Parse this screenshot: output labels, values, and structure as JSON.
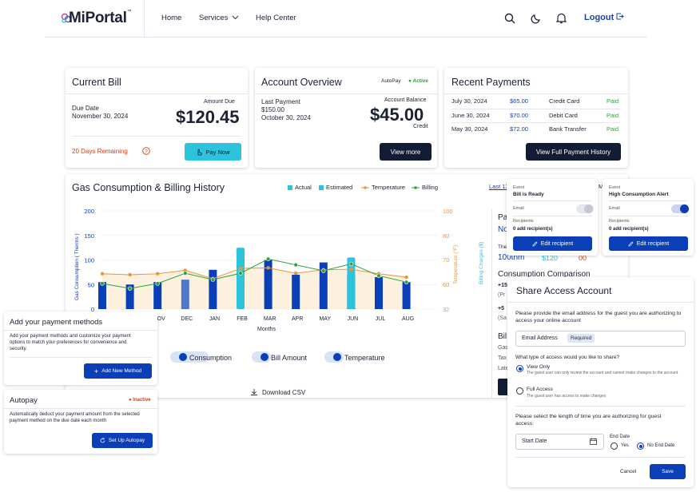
{
  "header": {
    "logo": "MiPortal",
    "logo_tm": "™",
    "nav": [
      "Home",
      "Services",
      "Help Center"
    ],
    "logout": "Logout"
  },
  "current_bill": {
    "title": "Current Bill",
    "due_label": "Due Date",
    "due_date": "November 30, 2024",
    "amount_label": "Amount Due",
    "amount": "$120.45",
    "remaining": "20 Days Remaining",
    "pay_button": "Pay Now"
  },
  "account_overview": {
    "title": "Account Overview",
    "autopay_label": "AutoPay",
    "autopay_status": "Active",
    "last_payment_label": "Last Payment",
    "last_payment_amount": "$150.00",
    "last_payment_date": "October 30, 2024",
    "balance_label": "Account Balance",
    "balance": "$45.00",
    "balance_note": "Credit",
    "view_button": "View more"
  },
  "recent_payments": {
    "title": "Recent Payments",
    "rows": [
      {
        "date": "July 30, 2024",
        "amount": "$65.00",
        "method": "Credit Card",
        "status": "Paid"
      },
      {
        "date": "June 30, 2024",
        "amount": "$70.00",
        "method": "Debit Card",
        "status": "Paid"
      },
      {
        "date": "May 30, 2024",
        "amount": "$72.00",
        "method": "Bank Transfer",
        "status": "Paid"
      }
    ],
    "history_button": "View Full Payment History"
  },
  "chart_panel": {
    "title": "Gas Consumption & Billing History",
    "legend": [
      "Actual",
      "Estimated",
      "Temperature",
      "Billing"
    ],
    "last_link": "Last 13",
    "y_left_label": "Gas Consumption ( Therms )",
    "y_right_label1": "Temperature (°F)",
    "y_right_label2": "Billing Charges ($)",
    "x_label": "Months",
    "toggles": [
      "Consumption",
      "Bill Amount",
      "Temperature"
    ],
    "download": "Download CSV"
  },
  "chart_data": {
    "type": "bar",
    "categories": [
      "OCT",
      "NOV",
      "DEC",
      "JAN",
      "FEB",
      "MAR",
      "APR",
      "MAY",
      "JUN",
      "JUL",
      "AUG"
    ],
    "visible_categories": [
      "CT",
      "NOV",
      "DEC",
      "JAN",
      "FEB",
      "MAR",
      "APR",
      "MAY",
      "JUN",
      "JUL",
      "AUG"
    ],
    "y_ticks": [
      0,
      50,
      100,
      150,
      200
    ],
    "y2_ticks": [
      32,
      60,
      70,
      80,
      100
    ],
    "ylim": [
      0,
      200
    ],
    "series": [
      {
        "name": "Actual",
        "values": [
          55,
          50,
          55,
          60,
          80,
          0,
          100,
          70,
          95,
          70,
          65,
          55
        ]
      },
      {
        "name": "Estimated",
        "values": [
          0,
          0,
          0,
          0,
          0,
          125,
          0,
          0,
          0,
          105,
          0,
          0
        ]
      },
      {
        "name": "Temperature",
        "values": [
          72,
          70,
          72,
          79,
          62,
          83,
          84,
          73,
          80,
          81,
          72,
          65
        ]
      },
      {
        "name": "Billing",
        "values": [
          52,
          42,
          52,
          73,
          60,
          73,
          102,
          90,
          78,
          92,
          68,
          55
        ]
      }
    ],
    "note": "first 3 bars partially hidden"
  },
  "side_panel": {
    "pa": "Pa",
    "no": "No",
    "the": "The",
    "usage": "100thm",
    "usage_amt": "$120",
    "extra": "00",
    "consumption_comparison": "Consumption Comparison",
    "plus15": "+15",
    "pr": "(Pr",
    "plus5": "+5",
    "sa": "(Sa",
    "bil": "Bil",
    "gas": "Gas",
    "tax": "Tax",
    "late": "Late"
  },
  "notif1": {
    "event_label": "Event",
    "event": "Bill is Ready",
    "email_label": "Email",
    "recipients_label": "Recipients",
    "recipients": "0 add recipient(s)",
    "button": "Edit recipient"
  },
  "notif2": {
    "event_label": "Event",
    "event": "High Consumption Alert",
    "email_label": "Email",
    "recipients_label": "Recipients",
    "recipients": "0 add recipient(s)",
    "button": "Edit recipient"
  },
  "share": {
    "title": "Share Access Account",
    "prompt": "Please provide the email address for the guest you are authorizing to access your online account",
    "email_placeholder": "Email Address",
    "required": "Required",
    "access_q": "What type of access would you like to share?",
    "view_only": "View Only",
    "view_only_desc": "The guest user can only review the account and cannot make changes to the account",
    "full_access": "Full Access",
    "full_access_desc": "The guest user has access to make changes",
    "length_q": "Please select the length of time you are authorizing for guest access:",
    "start_date": "Start Date",
    "end_date_label": "End Date",
    "yes": "Yes",
    "no_end": "No End Date",
    "cancel": "Cancel",
    "save": "Save"
  },
  "payment_methods": {
    "title": "Add your payment methods",
    "desc": "Add your payment methods and customize your payment options to match your preferences for convenience and security.",
    "button": "Add New Method"
  },
  "autopay": {
    "title": "Autopay",
    "status": "Inactive",
    "desc": "Automatically deduct your payment amount from the selected payment method on the due date each month",
    "button": "Set Up Autopay"
  },
  "colors": {
    "navy": "#121c34",
    "blue": "#0b3fb8",
    "cyan": "#2cc3dc",
    "orange": "#e8963a",
    "green": "#2aa33a",
    "red": "#d63a10"
  }
}
